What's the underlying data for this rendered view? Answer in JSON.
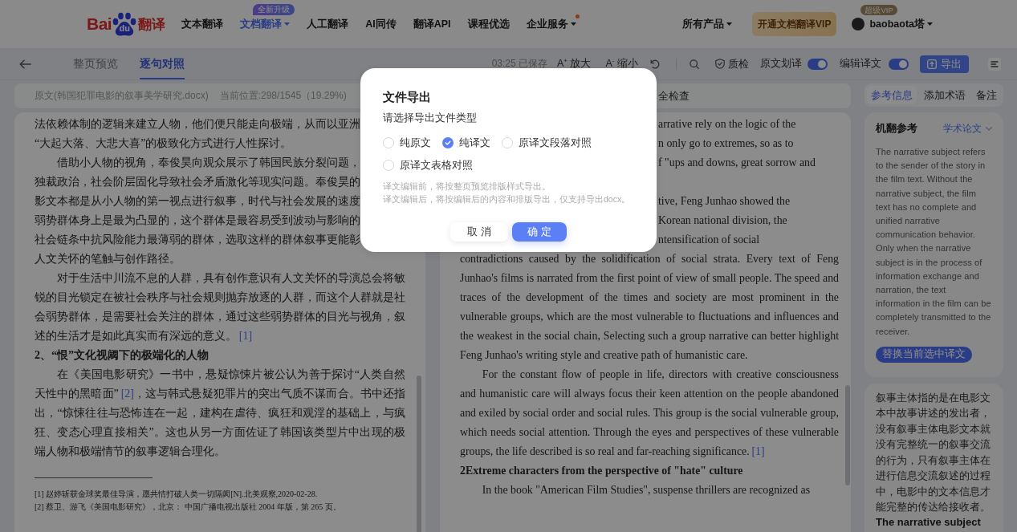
{
  "top_nav": {
    "logo": {
      "left": "Bai",
      "mark": "du",
      "right": "翻译"
    },
    "items": [
      {
        "label": "文本翻译",
        "selected": false,
        "dropdown": false,
        "dot": false
      },
      {
        "label": "文档翻译",
        "selected": true,
        "dropdown": true,
        "dot": false,
        "badge": "全新升级"
      },
      {
        "label": "人工翻译",
        "selected": false,
        "dropdown": false,
        "dot": false
      },
      {
        "label": "AI同传",
        "selected": false,
        "dropdown": false,
        "dot": false
      },
      {
        "label": "翻译API",
        "selected": false,
        "dropdown": false,
        "dot": false
      },
      {
        "label": "课程优选",
        "selected": false,
        "dropdown": false,
        "dot": false
      },
      {
        "label": "企业服务",
        "selected": false,
        "dropdown": true,
        "dot": true
      }
    ],
    "products": "所有产品",
    "vip_button": "开通文档翻译VIP",
    "user": {
      "name": "baobaota塔",
      "badge": "超级VIP"
    }
  },
  "toolbar": {
    "tabs": [
      {
        "label": "整页预览",
        "selected": false
      },
      {
        "label": "逐句对照",
        "selected": true
      }
    ],
    "save_status": "03:25 已保存",
    "zoom_buttons": [
      "A$^{+}$ 放大",
      "A$^{-}$ 缩小"
    ],
    "check_button": "质检",
    "toggles": [
      {
        "label": "原文划译",
        "on": true
      },
      {
        "label": "编辑译文",
        "on": true
      }
    ],
    "export_button": "导出"
  },
  "source": {
    "file": "原文(韩国犯罪电影的叙事美学研究.docx)",
    "position": "当前位置:298/1545（19.29%)",
    "paragraphs": [
      {
        "kind": "heads",
        "indent": false,
        "lines": [
          "法依赖体制的逻辑来建立人物，他们便只能走向极端，从而以亚洲"
        ],
        "rest": "“大起大落、大悲大喜”的极致化方式进行人性探讨。"
      },
      {
        "kind": "heads",
        "indent": true,
        "lines": [
          "借助小人物的视角，奉俊昊向观众展示了韩国民族分裂问题，",
          "独裁政治，社会阶层固化导致社会矛盾激化等现实问题。奉俊昊的",
          "影文本都是从小人物的第一视点进行叙事，时代与社会发展的速度",
          "弱势群体身上是最为凸显的，这个群体是最容易受到波动与影响的",
          "社会链条中抗风险能力最薄弱的群体，选取这样的群体叙事更能彰"
        ],
        "rest": "人文关怀的笔触与创作路径。"
      },
      {
        "kind": "body",
        "indent": true,
        "parts": [
          {
            "text": "对于生活中川流不息的人群，具有创作意识有人文关怀的导演总会将敏锐的目光锁定在被社会秩序与社会规则抛弃放逐的人群，而这个人群就是社会弱势群体，是需要社会关注的群体，通过这些弱势群体的目光与视角，叙述的生活才是如此真实而有深远的意义。"
          },
          {
            "ref": "[1]"
          }
        ]
      },
      {
        "kind": "heading",
        "text": "2、“恨”文化视阈下的极端化的人物"
      },
      {
        "kind": "body",
        "indent": true,
        "parts": [
          {
            "text": "在《美国电影研究》一书中，悬疑惊悚片被公认为善于探讨“人类自然天性中的黑暗面”"
          },
          {
            "ref": "[2]"
          },
          {
            "text": "，这与韩式悬疑犯罪片的突出气质不谋而合。书中还指出，“惊悚往往与恐怖连在一起，建构在虐待、疯狂和观淫的基础上，与疯狂、变态心理直接相关”。这也从另一方面佐证了韩国该类型片中出现的极端人物和极端情节的叙事逻辑合理化。"
          }
        ]
      }
    ],
    "footnotes": [
      "[1] 赵婷斩获金球奖最佳导演，愿共情打破人类一切隔阂[N].北美观察,2020-02-28.",
      "[2] 蔡卫、游飞《美国电影研究》，北京： 中国广播电视出版社 2004 年版，第 265 页。"
    ]
  },
  "translation": {
    "header_link": "全检查",
    "paragraphs": [
      {
        "kind": "tails",
        "lines": [
          "arrative rely on the logic of the",
          "n only go to extremes, so as to",
          "f \"ups and downs, great sorrow and"
        ]
      },
      {
        "kind": "tails",
        "lines": [
          "tive, Feng Junhao showed the",
          "Korean national division, the",
          "ntensification of social"
        ],
        "rest": "contradictions caused by the solidification of social strata. Every text of Feng Junhao's films is narrated from the first point of view of small people. The speed and traces of the development of the times and society are most prominent in the vulnerable groups, which are the most vulnerable to fluctuations and influences and the weakest in the social chain, Selecting such a group narrative can better highlight Feng Junhao's writing style and creative path of humanistic care."
      },
      {
        "kind": "body",
        "indent": true,
        "parts": [
          {
            "text": "For the constant flow of people in life, directors with creative consciousness and humanistic care will always focus their keen attention on the people abandoned and exiled by social order and social rules. This group is the social vulnerable group, which needs social attention. Through the eyes and perspectives of these vulnerable groups, the life described is so real and far-reaching significance."
          },
          {
            "ref": "[1]"
          }
        ]
      },
      {
        "kind": "heading",
        "text": "2Extreme characters from the perspective of \"hate\" culture"
      },
      {
        "kind": "body",
        "indent": true,
        "parts": [
          {
            "text": "In the book \"American Film Studies\", suspense thrillers are recognized as"
          }
        ]
      }
    ]
  },
  "sidebar": {
    "tabs": [
      {
        "label": "参考信息",
        "selected": true
      },
      {
        "label": "添加术语",
        "selected": false
      },
      {
        "label": "备注",
        "selected": false
      }
    ],
    "reference": {
      "title": "机翻参考",
      "domain": "学术论文",
      "text": "The narrative subject refers to the sender of the story in the film text. Without the narrative subject, the film text has no complete and unified narrative communication behavior. Only when the narrative subject is in the process of information exchange and narration, the text information in the film can be completely transmitted to the receiver.",
      "button": "替换当前选中译文"
    },
    "note": {
      "text": "叙事主体指的是在电影文本中故事讲述的发出者，没有叙事主体电影文本就没有完整统一的叙事交流的行为，只有叙事主体在进行信息交流叙述的过程中，电影中的文本信息才能完整的传达给接收者。",
      "next": "The narrative subject"
    }
  },
  "dialog": {
    "title": "文件导出",
    "prompt": "请选择导出文件类型",
    "options": [
      {
        "label": "纯原文",
        "selected": false
      },
      {
        "label": "纯译文",
        "selected": true
      },
      {
        "label": "原译文段落对照",
        "selected": false
      },
      {
        "label": "原译文表格对照",
        "selected": false
      }
    ],
    "hints": [
      "译文编辑前，将按整页预览排版样式导出。",
      "译文编辑后，将按编辑后的内容和排版导出，仅支持导出docx。"
    ],
    "buttons": [
      {
        "label": "取 消",
        "kind": "secondary"
      },
      {
        "label": "确 定",
        "kind": "primary"
      }
    ]
  }
}
